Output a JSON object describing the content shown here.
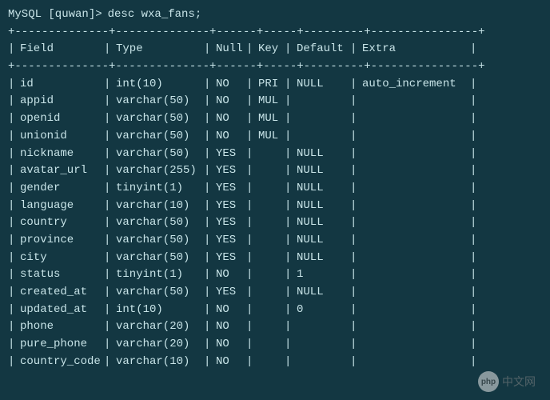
{
  "prompt_prefix": "MySQL [quwan]>",
  "command": "desc wxa_fans;",
  "columns": {
    "field": "Field",
    "type": "Type",
    "null": "Null",
    "key": "Key",
    "default": "Default",
    "extra": "Extra"
  },
  "rows": [
    {
      "field": "id",
      "type": "int(10)",
      "null": "NO",
      "key": "PRI",
      "default": "NULL",
      "extra": "auto_increment"
    },
    {
      "field": "appid",
      "type": "varchar(50)",
      "null": "NO",
      "key": "MUL",
      "default": "",
      "extra": ""
    },
    {
      "field": "openid",
      "type": "varchar(50)",
      "null": "NO",
      "key": "MUL",
      "default": "",
      "extra": ""
    },
    {
      "field": "unionid",
      "type": "varchar(50)",
      "null": "NO",
      "key": "MUL",
      "default": "",
      "extra": ""
    },
    {
      "field": "nickname",
      "type": "varchar(50)",
      "null": "YES",
      "key": "",
      "default": "NULL",
      "extra": ""
    },
    {
      "field": "avatar_url",
      "type": "varchar(255)",
      "null": "YES",
      "key": "",
      "default": "NULL",
      "extra": ""
    },
    {
      "field": "gender",
      "type": "tinyint(1)",
      "null": "YES",
      "key": "",
      "default": "NULL",
      "extra": ""
    },
    {
      "field": "language",
      "type": "varchar(10)",
      "null": "YES",
      "key": "",
      "default": "NULL",
      "extra": ""
    },
    {
      "field": "country",
      "type": "varchar(50)",
      "null": "YES",
      "key": "",
      "default": "NULL",
      "extra": ""
    },
    {
      "field": "province",
      "type": "varchar(50)",
      "null": "YES",
      "key": "",
      "default": "NULL",
      "extra": ""
    },
    {
      "field": "city",
      "type": "varchar(50)",
      "null": "YES",
      "key": "",
      "default": "NULL",
      "extra": ""
    },
    {
      "field": "status",
      "type": "tinyint(1)",
      "null": "NO",
      "key": "",
      "default": "1",
      "extra": ""
    },
    {
      "field": "created_at",
      "type": "varchar(50)",
      "null": "YES",
      "key": "",
      "default": "NULL",
      "extra": ""
    },
    {
      "field": "updated_at",
      "type": "int(10)",
      "null": "NO",
      "key": "",
      "default": "0",
      "extra": ""
    },
    {
      "field": "phone",
      "type": "varchar(20)",
      "null": "NO",
      "key": "",
      "default": "",
      "extra": ""
    },
    {
      "field": "pure_phone",
      "type": "varchar(20)",
      "null": "NO",
      "key": "",
      "default": "",
      "extra": ""
    },
    {
      "field": "country_code",
      "type": "varchar(10)",
      "null": "NO",
      "key": "",
      "default": "",
      "extra": ""
    }
  ],
  "divider": "+--------------+--------------+------+-----+---------+----------------+",
  "watermark": {
    "logo": "php",
    "text": "中文网"
  }
}
